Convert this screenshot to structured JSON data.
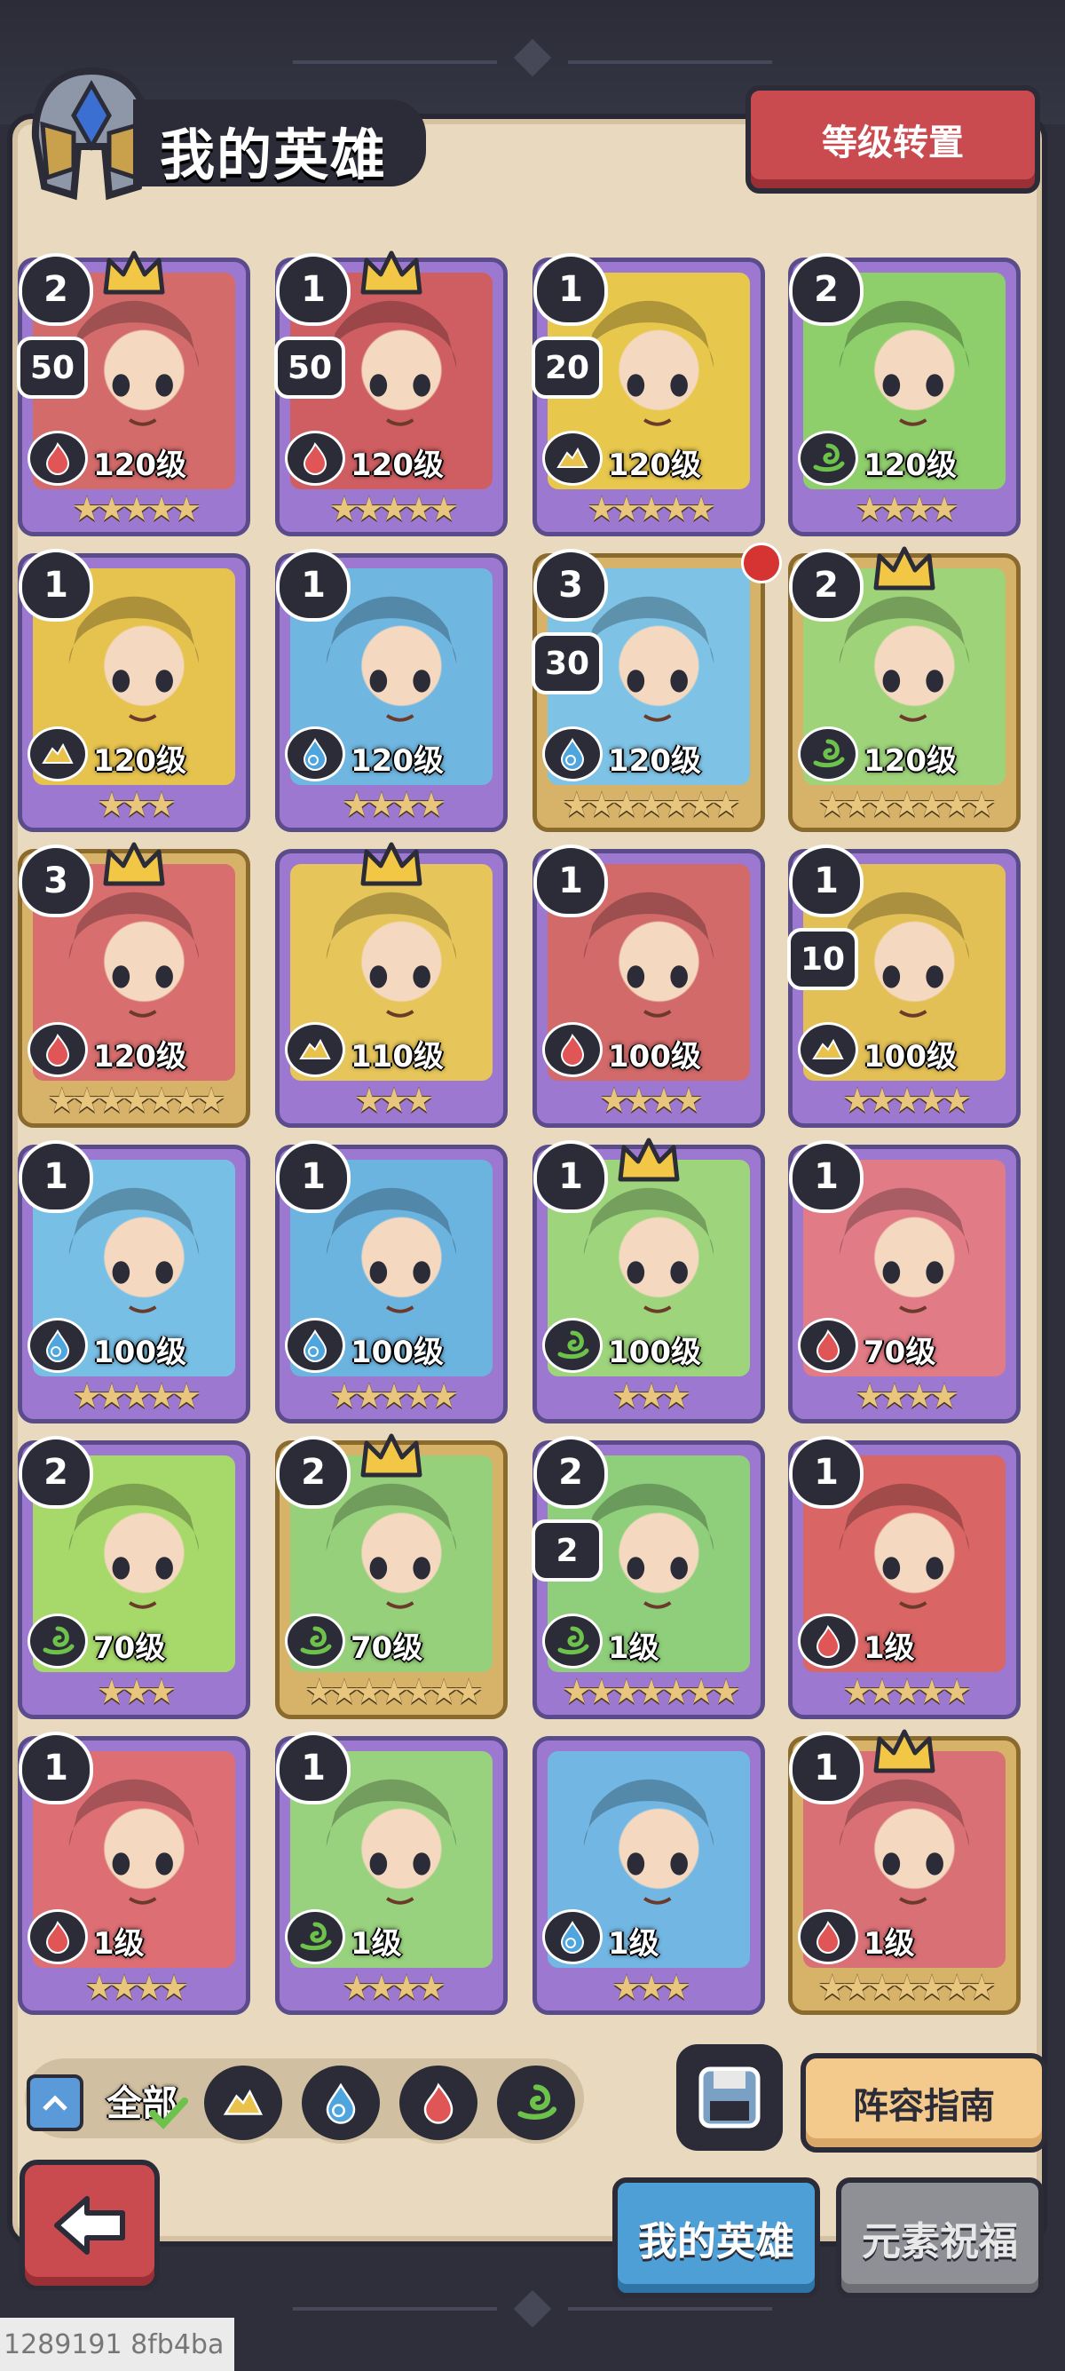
{
  "header": {
    "title": "我的英雄",
    "reset_button": "等级转置"
  },
  "heroes": [
    {
      "rank": "2",
      "count": "50",
      "level": "120级",
      "stars": "★★★★★",
      "element": "fire",
      "crown": true,
      "frame": "purple",
      "bg": "#d46b6b",
      "red_dot": false
    },
    {
      "rank": "1",
      "count": "50",
      "level": "120级",
      "stars": "★★★★★",
      "element": "fire",
      "crown": true,
      "frame": "purple",
      "bg": "#cf5e62",
      "red_dot": false
    },
    {
      "rank": "1",
      "count": "20",
      "level": "120级",
      "stars": "★★★★★",
      "element": "earth",
      "crown": false,
      "frame": "purple",
      "bg": "#e8c74d",
      "red_dot": false
    },
    {
      "rank": "2",
      "count": "",
      "level": "120级",
      "stars": "★★★★",
      "element": "wind",
      "crown": false,
      "frame": "purple",
      "bg": "#8fcf6b",
      "red_dot": false
    },
    {
      "rank": "1",
      "count": "",
      "level": "120级",
      "stars": "★★★",
      "element": "earth",
      "crown": false,
      "frame": "purple",
      "bg": "#e6c24e",
      "red_dot": false
    },
    {
      "rank": "1",
      "count": "",
      "level": "120级",
      "stars": "★★★★",
      "element": "water",
      "crown": false,
      "frame": "purple",
      "bg": "#6fb6e0",
      "red_dot": false
    },
    {
      "rank": "3",
      "count": "30",
      "level": "120级",
      "stars": "★★★★★★★",
      "element": "water",
      "crown": false,
      "frame": "gold",
      "bg": "#7ec3e6",
      "red_dot": true
    },
    {
      "rank": "2",
      "count": "",
      "level": "120级",
      "stars": "★★★★★★★",
      "element": "wind",
      "crown": true,
      "frame": "gold",
      "bg": "#9ed37a",
      "red_dot": false
    },
    {
      "rank": "3",
      "count": "",
      "level": "120级",
      "stars": "★★★★★★★",
      "element": "fire",
      "crown": true,
      "frame": "gold",
      "bg": "#d86e6e",
      "red_dot": false
    },
    {
      "rank": "",
      "count": "",
      "level": "110级",
      "stars": "★★★",
      "element": "earth",
      "crown": true,
      "frame": "purple",
      "bg": "#e6c65a",
      "red_dot": false
    },
    {
      "rank": "1",
      "count": "",
      "level": "100级",
      "stars": "★★★★",
      "element": "fire",
      "crown": false,
      "frame": "purple",
      "bg": "#d26a6a",
      "red_dot": false
    },
    {
      "rank": "1",
      "count": "10",
      "level": "100级",
      "stars": "★★★★★",
      "element": "earth",
      "crown": false,
      "frame": "purple",
      "bg": "#e3c055",
      "red_dot": false
    },
    {
      "rank": "1",
      "count": "",
      "level": "100级",
      "stars": "★★★★★",
      "element": "water",
      "crown": false,
      "frame": "purple",
      "bg": "#78bfe5",
      "red_dot": false
    },
    {
      "rank": "1",
      "count": "",
      "level": "100级",
      "stars": "★★★★★",
      "element": "water",
      "crown": false,
      "frame": "purple",
      "bg": "#6cb4e0",
      "red_dot": false
    },
    {
      "rank": "1",
      "count": "",
      "level": "100级",
      "stars": "★★★",
      "element": "wind",
      "crown": true,
      "frame": "purple",
      "bg": "#9dd47c",
      "red_dot": false
    },
    {
      "rank": "1",
      "count": "",
      "level": "70级",
      "stars": "★★★★",
      "element": "fire",
      "crown": false,
      "frame": "purple",
      "bg": "#e17b86",
      "red_dot": false
    },
    {
      "rank": "2",
      "count": "",
      "level": "70级",
      "stars": "★★★",
      "element": "wind",
      "crown": false,
      "frame": "purple",
      "bg": "#a6d86a",
      "red_dot": false
    },
    {
      "rank": "2",
      "count": "",
      "level": "70级",
      "stars": "★★★★★★★",
      "element": "wind",
      "crown": true,
      "frame": "gold",
      "bg": "#96d07b",
      "red_dot": false
    },
    {
      "rank": "2",
      "count": "2",
      "level": "1级",
      "stars": "★★★★★★★",
      "element": "wind",
      "crown": false,
      "frame": "purple",
      "bg": "#8fcf7b",
      "red_dot": false
    },
    {
      "rank": "1",
      "count": "",
      "level": "1级",
      "stars": "★★★★★",
      "element": "fire",
      "crown": false,
      "frame": "purple",
      "bg": "#d96565",
      "red_dot": false
    },
    {
      "rank": "1",
      "count": "",
      "level": "1级",
      "stars": "★★★★",
      "element": "fire",
      "crown": false,
      "frame": "purple",
      "bg": "#dd6f74",
      "red_dot": false
    },
    {
      "rank": "1",
      "count": "",
      "level": "1级",
      "stars": "★★★★",
      "element": "wind",
      "crown": false,
      "frame": "purple",
      "bg": "#98d27e",
      "red_dot": false
    },
    {
      "rank": "",
      "count": "",
      "level": "1级",
      "stars": "★★★",
      "element": "water",
      "crown": false,
      "frame": "purple",
      "bg": "#72b7e3",
      "red_dot": false
    },
    {
      "rank": "1",
      "count": "",
      "level": "1级",
      "stars": "★★★★★★★",
      "element": "fire",
      "crown": true,
      "frame": "gold",
      "bg": "#d97076",
      "red_dot": false
    }
  ],
  "filters": {
    "all_label": "全部",
    "elements": [
      "earth",
      "water",
      "fire",
      "wind"
    ]
  },
  "buttons": {
    "lineup_guide": "阵容指南"
  },
  "tabs": {
    "my_heroes": "我的英雄",
    "element_blessing": "元素祝福"
  },
  "colors": {
    "fire": "#e05555",
    "water": "#4fa5dd",
    "earth": "#e8c24a",
    "wind": "#6cc24a"
  },
  "watermark": "1289191 8fb4ba"
}
